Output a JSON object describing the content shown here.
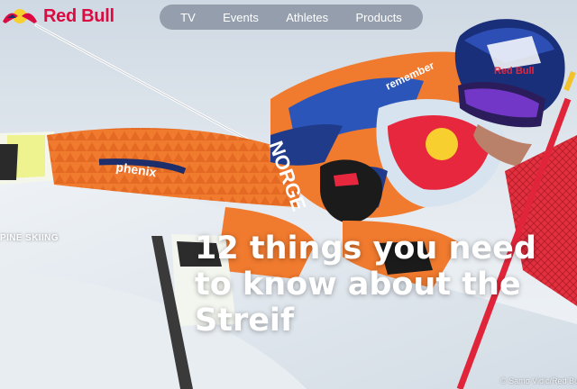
{
  "brand": {
    "logo_text": "Red Bull",
    "logo_icon": "red-bull-logo",
    "color": "#db0a40"
  },
  "nav": {
    "items": [
      "TV",
      "Events",
      "Athletes",
      "Products"
    ]
  },
  "article": {
    "category": "PINE SKIING",
    "headline_lines": [
      "12 things you need",
      "to know about the",
      "Streif"
    ],
    "credit": "© Samo Vidic/Red Bu"
  },
  "image": {
    "suit_text_1": "phenix",
    "suit_text_2": "NORGE",
    "suit_text_3": "remember",
    "suit_text_4": "Red Bull",
    "colors": {
      "suit_orange": "#ef7a2f",
      "suit_blue": "#1f3b8a",
      "gate_red": "#e0253a",
      "snow": "#dfe7ee"
    }
  }
}
